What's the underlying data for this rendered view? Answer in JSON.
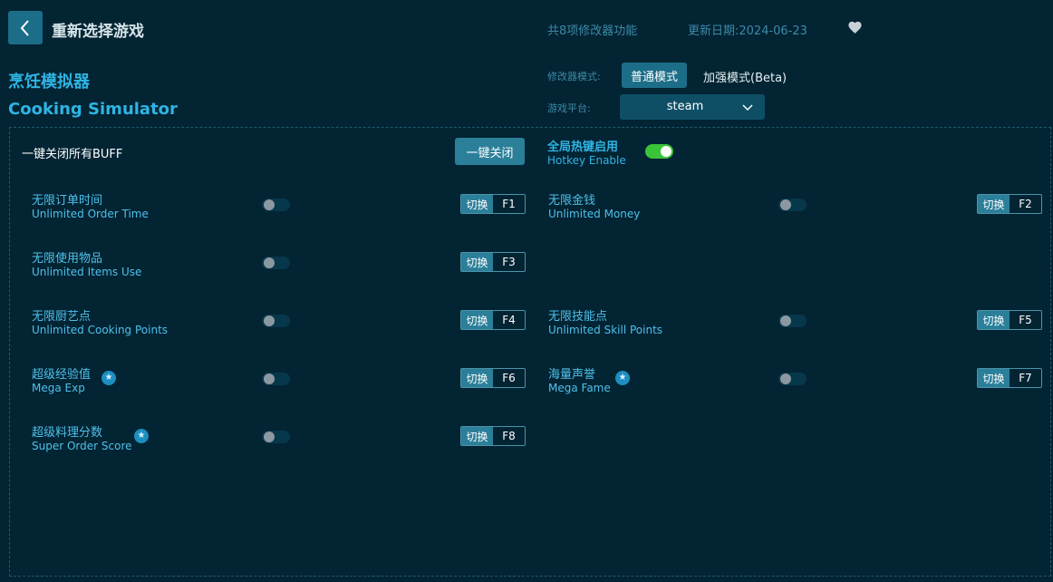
{
  "header": {
    "reselect_label": "重新选择游戏",
    "feature_count": "共8项修改器功能",
    "update_date": "更新日期:2024-06-23"
  },
  "game": {
    "name_cn": "烹饪模拟器",
    "name_en": "Cooking Simulator"
  },
  "mode": {
    "label": "修改器模式:",
    "normal": "普通模式",
    "beta": "加强模式(Beta)",
    "selected": "普通模式"
  },
  "platform": {
    "label": "游戏平台:",
    "value": "steam"
  },
  "buff": {
    "title": "一键关闭所有BUFF",
    "close_all_label": "一键关闭"
  },
  "hotkey": {
    "label_cn": "全局热键启用",
    "label_en": "Hotkey Enable",
    "enabled": true
  },
  "switch_label": "切换",
  "features": [
    {
      "cn": "无限订单时间",
      "en": "Unlimited Order Time",
      "key": "F1",
      "star": false,
      "enabled": false
    },
    {
      "cn": "无限金钱",
      "en": "Unlimited Money",
      "key": "F2",
      "star": false,
      "enabled": false
    },
    {
      "cn": "无限使用物品",
      "en": "Unlimited Items Use",
      "key": "F3",
      "star": false,
      "enabled": false
    },
    {
      "cn": "无限厨艺点",
      "en": "Unlimited Cooking Points",
      "key": "F4",
      "star": false,
      "enabled": false
    },
    {
      "cn": "无限技能点",
      "en": "Unlimited Skill Points",
      "key": "F5",
      "star": false,
      "enabled": false
    },
    {
      "cn": "超级经验值",
      "en": "Mega Exp",
      "key": "F6",
      "star": true,
      "enabled": false
    },
    {
      "cn": "海量声誉",
      "en": "Mega Fame",
      "key": "F7",
      "star": true,
      "enabled": false
    },
    {
      "cn": "超级料理分数",
      "en": "Super Order Score",
      "key": "F8",
      "star": true,
      "enabled": false
    }
  ],
  "colors": {
    "background": "#032433",
    "accent": "#2fb4e3",
    "button": "#1c6d88",
    "toggle_on": "#3ac43a"
  },
  "icons": [
    "back-arrow-icon",
    "heart-icon",
    "chevron-down-icon",
    "star-icon"
  ]
}
